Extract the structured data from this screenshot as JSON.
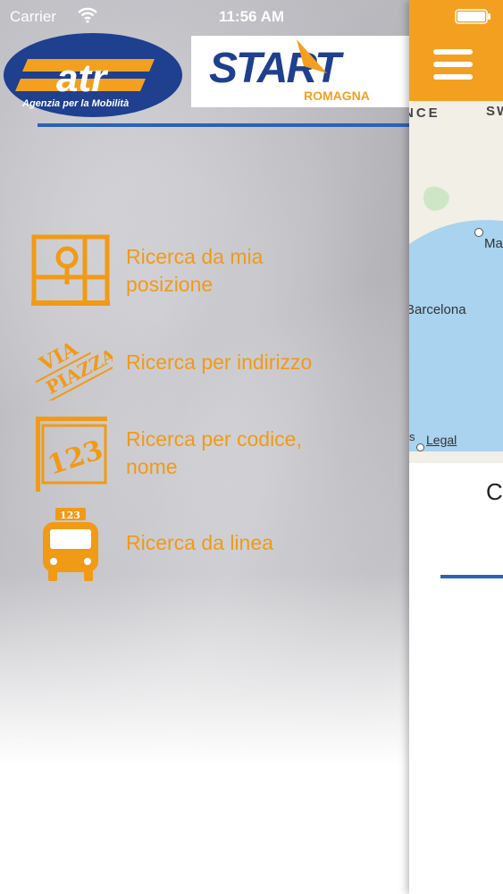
{
  "status_bar": {
    "carrier": "Carrier",
    "time": "11:56 AM"
  },
  "logos": {
    "atr": {
      "name": "atr",
      "tagline": "Agenzia per la Mobilità",
      "color": "#1f3f8f",
      "accent": "#f3a020"
    },
    "start": {
      "name": "START",
      "sub": "ROMAGNA",
      "color": "#1f3f8f",
      "accent": "#f3a020"
    }
  },
  "menu": {
    "items": [
      {
        "label_line1": "Ricerca da mia",
        "label_line2": "posizione",
        "icon": "map-pin-icon"
      },
      {
        "label_line1": "Ricerca per indirizzo",
        "icon": "street-sign-icon",
        "icon_text_1": "VIA",
        "icon_text_2": "PIAZZA"
      },
      {
        "label_line1": "Ricerca per codice,",
        "label_line2": "nome",
        "icon": "bus-stop-code-icon",
        "icon_text": "123"
      },
      {
        "label_line1": "Ricerca da linea",
        "icon": "bus-icon",
        "icon_text": "123"
      }
    ]
  },
  "map": {
    "labels": {
      "france": "NCE",
      "sw": "SW",
      "marseille": "Ma",
      "barcelona": "Barcelona",
      "legal": "Legal",
      "s": "s"
    }
  },
  "right_panel": {
    "partial_text": "C"
  },
  "colors": {
    "orange": "#f19a15",
    "blue": "#2a63b6",
    "topbar": "#f3a020"
  }
}
